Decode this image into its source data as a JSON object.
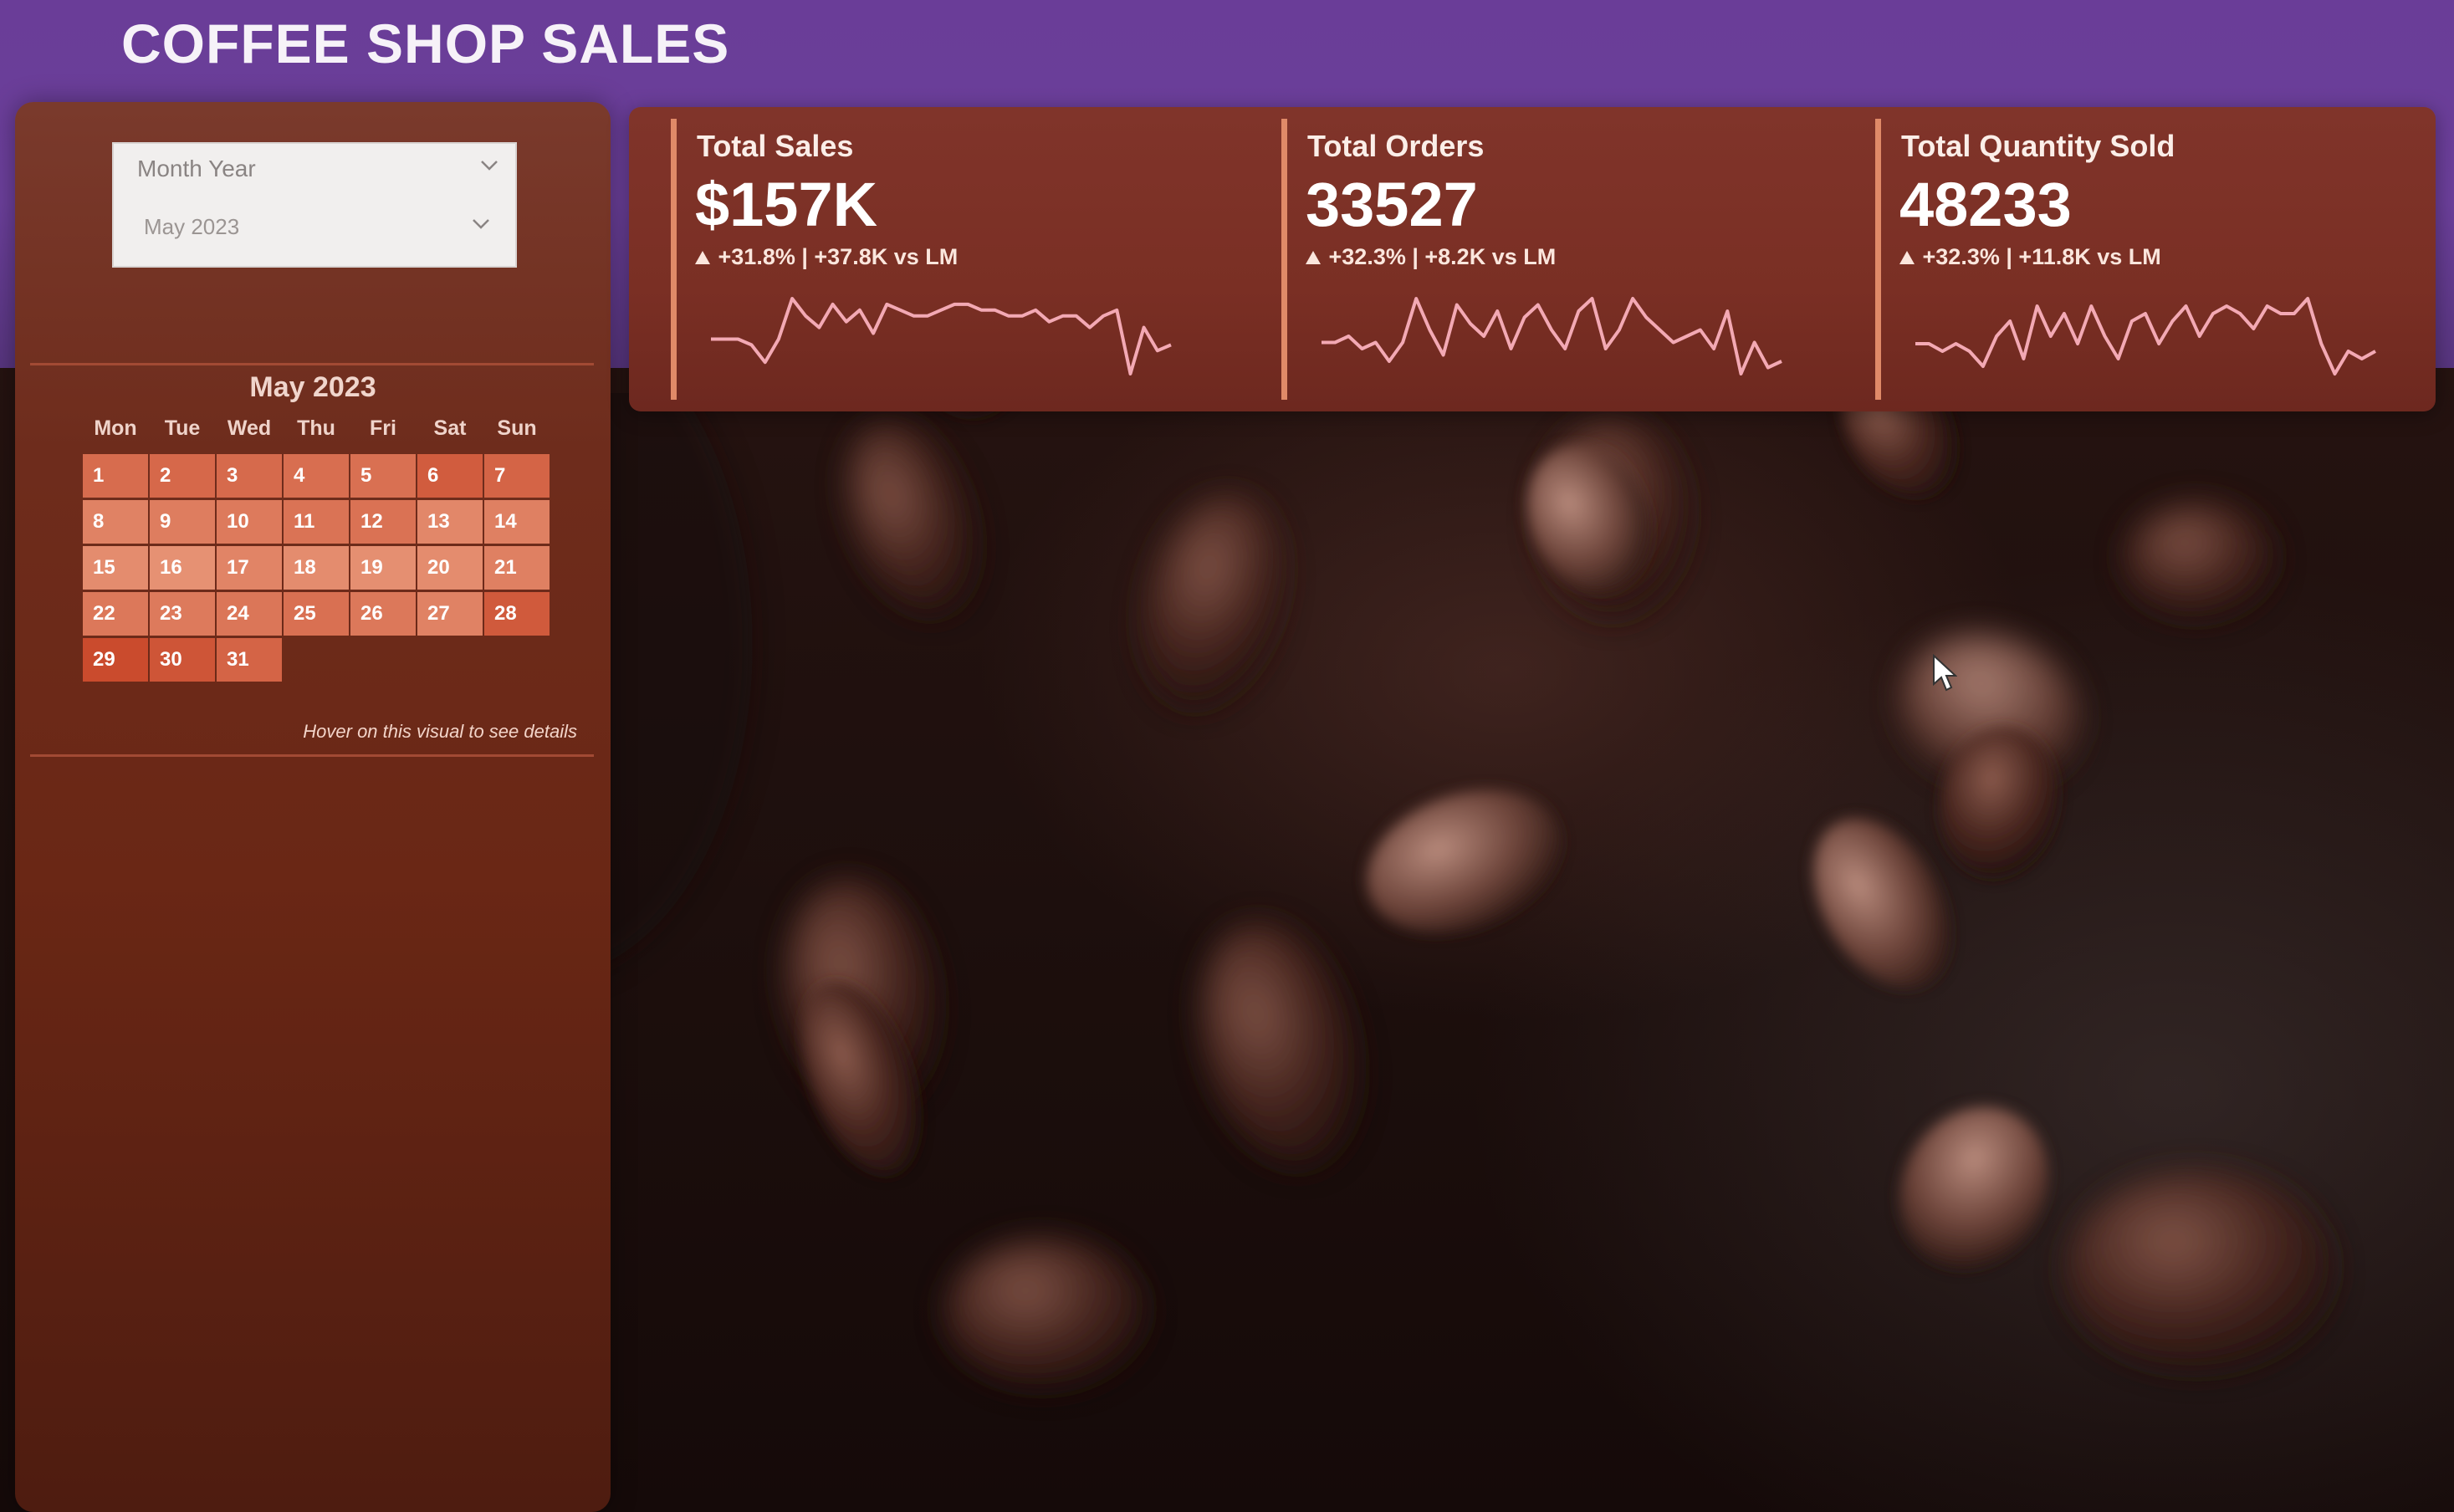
{
  "header": {
    "title": "COFFEE SHOP SALES"
  },
  "slicer": {
    "label": "Month Year",
    "value": "May 2023"
  },
  "calendar": {
    "title": "May 2023",
    "weekdays": [
      "Mon",
      "Tue",
      "Wed",
      "Thu",
      "Fri",
      "Sat",
      "Sun"
    ],
    "start_offset": 0,
    "days": [
      {
        "d": "1",
        "level": 0.62
      },
      {
        "d": "2",
        "level": 0.66
      },
      {
        "d": "3",
        "level": 0.64
      },
      {
        "d": "4",
        "level": 0.6
      },
      {
        "d": "5",
        "level": 0.58
      },
      {
        "d": "6",
        "level": 0.78
      },
      {
        "d": "7",
        "level": 0.7
      },
      {
        "d": "8",
        "level": 0.4
      },
      {
        "d": "9",
        "level": 0.45
      },
      {
        "d": "10",
        "level": 0.48
      },
      {
        "d": "11",
        "level": 0.55
      },
      {
        "d": "12",
        "level": 0.56
      },
      {
        "d": "13",
        "level": 0.35
      },
      {
        "d": "14",
        "level": 0.42
      },
      {
        "d": "15",
        "level": 0.3
      },
      {
        "d": "16",
        "level": 0.25
      },
      {
        "d": "17",
        "level": 0.38
      },
      {
        "d": "18",
        "level": 0.3
      },
      {
        "d": "19",
        "level": 0.27
      },
      {
        "d": "20",
        "level": 0.3
      },
      {
        "d": "21",
        "level": 0.42
      },
      {
        "d": "22",
        "level": 0.5
      },
      {
        "d": "23",
        "level": 0.48
      },
      {
        "d": "24",
        "level": 0.52
      },
      {
        "d": "25",
        "level": 0.58
      },
      {
        "d": "26",
        "level": 0.5
      },
      {
        "d": "27",
        "level": 0.4
      },
      {
        "d": "28",
        "level": 0.8
      },
      {
        "d": "29",
        "level": 0.95
      },
      {
        "d": "30",
        "level": 0.85
      },
      {
        "d": "31",
        "level": 0.7
      }
    ],
    "hover_note": "Hover on this visual to see details"
  },
  "kpis": [
    {
      "name": "Total Sales",
      "value": "$157K",
      "delta": "+31.8% | +37.8K vs LM",
      "spark": [
        5,
        5,
        5,
        4.5,
        3,
        5,
        8.5,
        7,
        6,
        8,
        6.5,
        7.5,
        5.5,
        8,
        7.5,
        7,
        7,
        7.5,
        8,
        8,
        7.5,
        7.5,
        7,
        7,
        7.5,
        6.5,
        7,
        7,
        6,
        7,
        7.5,
        2,
        6,
        4,
        4.5
      ]
    },
    {
      "name": "Total Orders",
      "value": "33527",
      "delta": "+32.3% | +8.2K vs LM",
      "spark": [
        4,
        4,
        4.5,
        3.5,
        4,
        2.5,
        4,
        7.5,
        5,
        3,
        7,
        5.5,
        4.5,
        6.5,
        3.5,
        6,
        7,
        5,
        3.5,
        6.5,
        7.5,
        3.5,
        5,
        7.5,
        6,
        5,
        4,
        4.5,
        5,
        3.5,
        6.5,
        1.5,
        4,
        2,
        2.5
      ]
    },
    {
      "name": "Total Quantity Sold",
      "value": "48233",
      "delta": "+32.3% | +11.8K vs LM",
      "spark": [
        4,
        4,
        3.5,
        4,
        3.5,
        2.5,
        4.5,
        5.5,
        3,
        6.5,
        4.5,
        6,
        4,
        6.5,
        4.5,
        3,
        5.5,
        6,
        4,
        5.5,
        6.5,
        4.5,
        6,
        6.5,
        6,
        5,
        6.5,
        6,
        6,
        7,
        4,
        2,
        3.5,
        3,
        3.5
      ]
    }
  ],
  "colors": {
    "spark": "#f3a9b4",
    "kpi_accent": "#e08a68"
  },
  "icons": {
    "chevron": "chevron-down-icon",
    "cursor": "mouse-pointer-icon",
    "delta": "triangle-up-icon"
  }
}
